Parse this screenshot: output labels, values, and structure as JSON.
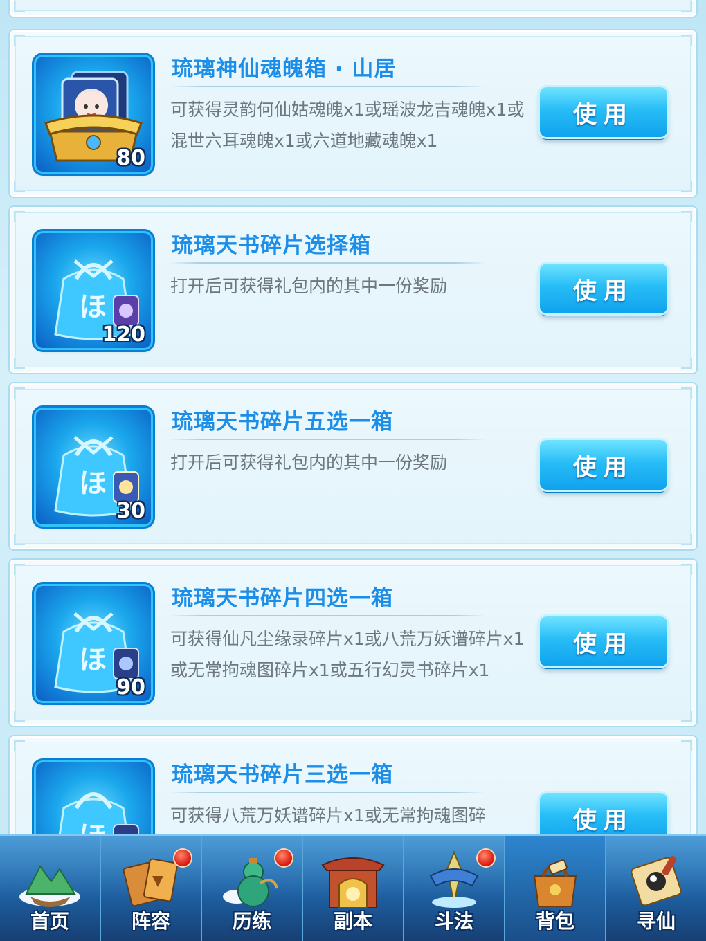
{
  "items": [
    {
      "title": "琉璃神仙魂魄箱 · 山居",
      "description": "可获得灵韵何仙姑魂魄x1或瑶波龙吉魂魄x1或混世六耳魂魄x1或六道地藏魂魄x1",
      "quantity": "80",
      "button": "使用",
      "icon": "treasure-chest-icon"
    },
    {
      "title": "琉璃天书碎片选择箱",
      "description": "打开后可获得礼包内的其中一份奖励",
      "quantity": "120",
      "button": "使用",
      "icon": "gift-bag-icon"
    },
    {
      "title": "琉璃天书碎片五选一箱",
      "description": "打开后可获得礼包内的其中一份奖励",
      "quantity": "30",
      "button": "使用",
      "icon": "gift-bag-icon"
    },
    {
      "title": "琉璃天书碎片四选一箱",
      "description": "可获得仙凡尘缘录碎片x1或八荒万妖谱碎片x1或无常拘魂图碎片x1或五行幻灵书碎片x1",
      "quantity": "90",
      "button": "使用",
      "icon": "gift-bag-icon"
    },
    {
      "title": "琉璃天书碎片三选一箱",
      "description": "可获得八荒万妖谱碎片x1或无常拘魂图碎",
      "quantity": "",
      "button": "使用",
      "icon": "gift-bag-icon"
    }
  ],
  "nav": [
    {
      "label": "首页",
      "icon": "home-island-icon",
      "badge": false
    },
    {
      "label": "阵容",
      "icon": "cards-icon",
      "badge": true
    },
    {
      "label": "历练",
      "icon": "gourd-icon",
      "badge": true
    },
    {
      "label": "副本",
      "icon": "gate-icon",
      "badge": false
    },
    {
      "label": "斗法",
      "icon": "sword-crest-icon",
      "badge": true
    },
    {
      "label": "背包",
      "icon": "bag-icon",
      "badge": false,
      "active": true
    },
    {
      "label": "寻仙",
      "icon": "scroll-icon",
      "badge": false
    }
  ],
  "colors": {
    "title": "#1d8ee8",
    "description": "#6e7780",
    "button": "#27bdf6",
    "badge": "#e2221a"
  }
}
